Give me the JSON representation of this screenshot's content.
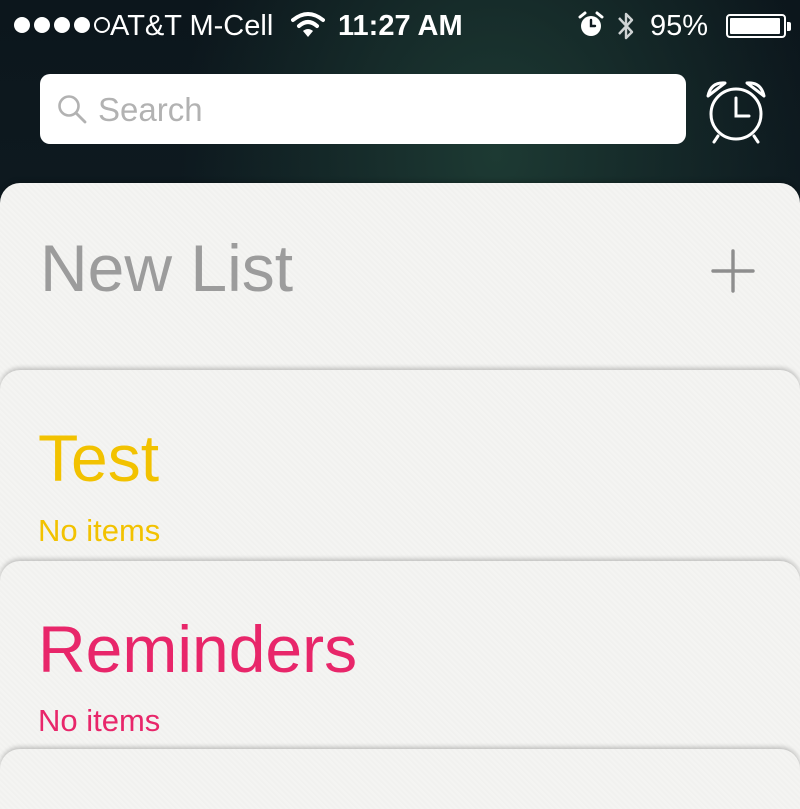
{
  "status_bar": {
    "carrier": "AT&T M-Cell",
    "time": "11:27 AM",
    "battery_percent": "95%",
    "battery_level": 0.95,
    "signal_bars_filled": 4,
    "signal_bars_total": 5,
    "icons": [
      "signal-dots-icon",
      "wifi-icon",
      "alarm-icon",
      "bluetooth-icon",
      "battery-icon"
    ]
  },
  "search": {
    "placeholder": "Search",
    "value": ""
  },
  "toolbar": {
    "alarm_button_icon": "alarm-clock-icon"
  },
  "new_list": {
    "title": "New List",
    "add_icon": "plus-icon"
  },
  "lists": [
    {
      "title": "Test",
      "subtitle": "No items",
      "color": "#f2c200"
    },
    {
      "title": "Reminders",
      "subtitle": "No items",
      "color": "#e8266a"
    }
  ],
  "colors": {
    "search_bg": "#ffffff",
    "card_bg": "#f4f4f2",
    "new_list_gray": "#9c9c9c",
    "test_yellow": "#f2c200",
    "reminders_pink": "#e8266a"
  }
}
